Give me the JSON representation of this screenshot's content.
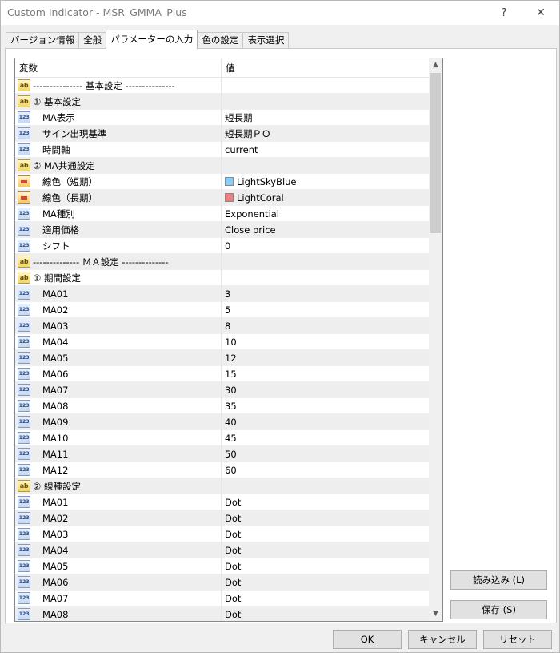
{
  "window": {
    "title": "Custom Indicator - MSR_GMMA_Plus",
    "help": "?",
    "close": "✕"
  },
  "tabs": [
    {
      "label": "バージョン情報",
      "active": false
    },
    {
      "label": "全般",
      "active": false
    },
    {
      "label": "パラメーターの入力",
      "active": true
    },
    {
      "label": "色の設定",
      "active": false
    },
    {
      "label": "表示選択",
      "active": false
    }
  ],
  "grid": {
    "col_variable": "変数",
    "col_value": "値",
    "rows": [
      {
        "type": "ab",
        "name": "--------------- 基本設定 ---------------",
        "value": "",
        "indent": false
      },
      {
        "type": "ab",
        "name": "① 基本設定",
        "value": "",
        "indent": false
      },
      {
        "type": "num",
        "name": "MA表示",
        "value": "短長期",
        "indent": true
      },
      {
        "type": "num",
        "name": "サイン出現基準",
        "value": "短長期ＰＯ",
        "indent": true
      },
      {
        "type": "num",
        "name": "時間軸",
        "value": "current",
        "indent": true
      },
      {
        "type": "ab",
        "name": "② MA共通設定",
        "value": "",
        "indent": false
      },
      {
        "type": "color",
        "name": "線色（短期）",
        "value": "LightSkyBlue",
        "swatch": "#87cefa",
        "indent": true
      },
      {
        "type": "color",
        "name": "線色（長期）",
        "value": "LightCoral",
        "swatch": "#f08080",
        "indent": true
      },
      {
        "type": "num",
        "name": "MA種別",
        "value": "Exponential",
        "indent": true
      },
      {
        "type": "num",
        "name": "適用価格",
        "value": "Close price",
        "indent": true
      },
      {
        "type": "num",
        "name": "シフト",
        "value": "0",
        "indent": true
      },
      {
        "type": "ab",
        "name": "-------------- ＭＡ設定 --------------",
        "value": "",
        "indent": false
      },
      {
        "type": "ab",
        "name": "① 期間設定",
        "value": "",
        "indent": false
      },
      {
        "type": "num",
        "name": "MA01",
        "value": "3",
        "indent": true
      },
      {
        "type": "num",
        "name": "MA02",
        "value": "5",
        "indent": true
      },
      {
        "type": "num",
        "name": "MA03",
        "value": "8",
        "indent": true
      },
      {
        "type": "num",
        "name": "MA04",
        "value": "10",
        "indent": true
      },
      {
        "type": "num",
        "name": "MA05",
        "value": "12",
        "indent": true
      },
      {
        "type": "num",
        "name": "MA06",
        "value": "15",
        "indent": true
      },
      {
        "type": "num",
        "name": "MA07",
        "value": "30",
        "indent": true
      },
      {
        "type": "num",
        "name": "MA08",
        "value": "35",
        "indent": true
      },
      {
        "type": "num",
        "name": "MA09",
        "value": "40",
        "indent": true
      },
      {
        "type": "num",
        "name": "MA10",
        "value": "45",
        "indent": true
      },
      {
        "type": "num",
        "name": "MA11",
        "value": "50",
        "indent": true
      },
      {
        "type": "num",
        "name": "MA12",
        "value": "60",
        "indent": true
      },
      {
        "type": "ab",
        "name": "② 線種設定",
        "value": "",
        "indent": false
      },
      {
        "type": "num",
        "name": "MA01",
        "value": "Dot",
        "indent": true
      },
      {
        "type": "num",
        "name": "MA02",
        "value": "Dot",
        "indent": true
      },
      {
        "type": "num",
        "name": "MA03",
        "value": "Dot",
        "indent": true
      },
      {
        "type": "num",
        "name": "MA04",
        "value": "Dot",
        "indent": true
      },
      {
        "type": "num",
        "name": "MA05",
        "value": "Dot",
        "indent": true
      },
      {
        "type": "num",
        "name": "MA06",
        "value": "Dot",
        "indent": true
      },
      {
        "type": "num",
        "name": "MA07",
        "value": "Dot",
        "indent": true
      },
      {
        "type": "num",
        "name": "MA08",
        "value": "Dot",
        "indent": true
      }
    ]
  },
  "icons": {
    "ab": "ab",
    "num": "123"
  },
  "scroll": {
    "up": "▲",
    "down": "▼"
  },
  "buttons": {
    "load": "読み込み (L)",
    "save": "保存 (S)",
    "ok": "OK",
    "cancel": "キャンセル",
    "reset": "リセット"
  }
}
